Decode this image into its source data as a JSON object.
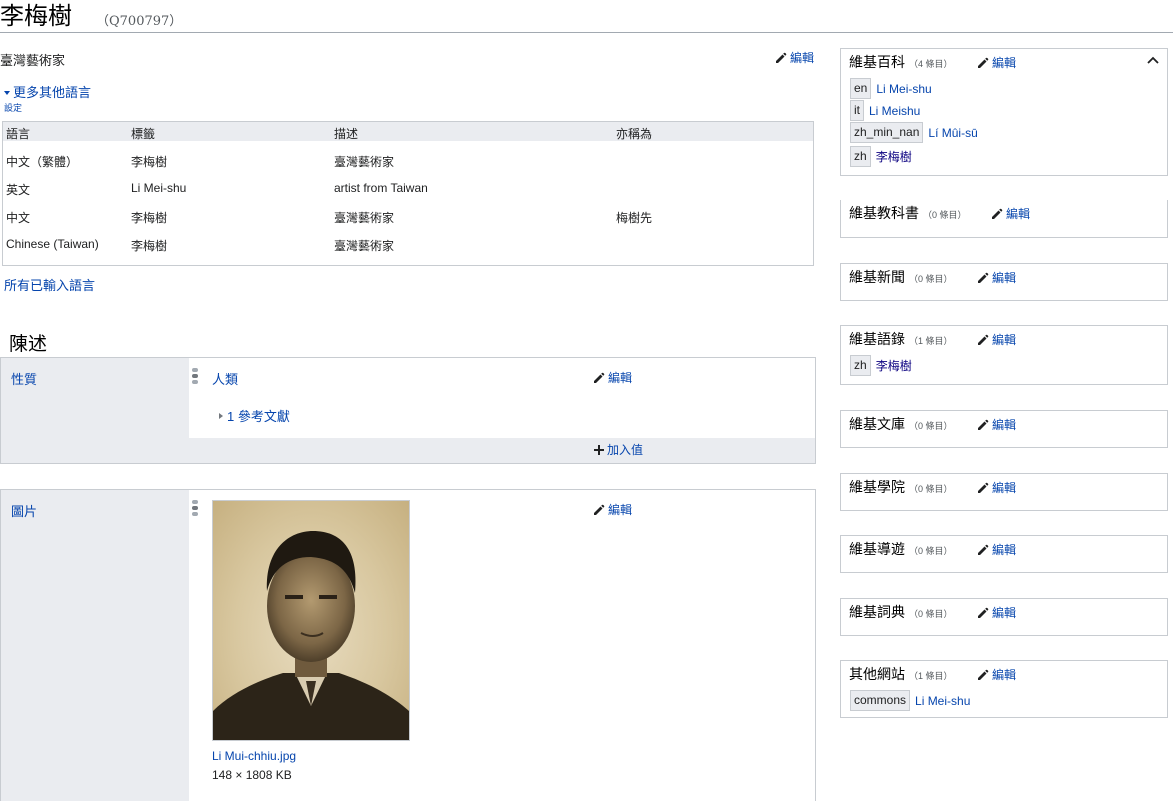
{
  "header": {
    "title": "李梅樹",
    "entity_id": "（Q700797）"
  },
  "edit_label": "編輯",
  "description": "臺灣藝術家",
  "more_languages": "更多其他語言",
  "settings": "設定",
  "languages_table": {
    "headers": [
      "語言",
      "標籤",
      "描述",
      "亦稱為"
    ],
    "rows": [
      [
        "中文（繁體）",
        "李梅樹",
        "臺灣藝術家",
        ""
      ],
      [
        "英文",
        "Li Mei-shu",
        "artist from Taiwan",
        ""
      ],
      [
        "中文",
        "李梅樹",
        "臺灣藝術家",
        "梅樹先"
      ],
      [
        "Chinese (Taiwan)",
        "李梅樹",
        "臺灣藝術家",
        ""
      ]
    ]
  },
  "all_languages": "所有已輸入語言",
  "statements_heading": "陳述",
  "statements": [
    {
      "property": "性質",
      "value": "人類",
      "references": "1 參考文獻",
      "add_value": "加入值"
    },
    {
      "property": "圖片",
      "file_name": "Li Mui-chhiu.jpg",
      "file_dims": "148 × 1808 KB"
    }
  ],
  "sitelinks": [
    {
      "title": "維基百科",
      "count": "（4 條目）",
      "links": [
        {
          "site": "en",
          "label": "Li Mei-shu"
        },
        {
          "site": "it",
          "label": "Li Meishu"
        },
        {
          "site": "zh_min_nan",
          "label": "Lí Mûi-sū"
        },
        {
          "site": "zh",
          "label": "李梅樹"
        }
      ]
    },
    {
      "title": "維基教科書",
      "count": "（0 條目）",
      "links": []
    },
    {
      "title": "維基新聞",
      "count": "（0 條目）",
      "links": []
    },
    {
      "title": "維基語錄",
      "count": "（1 條目）",
      "links": [
        {
          "site": "zh",
          "label": "李梅樹"
        }
      ]
    },
    {
      "title": "維基文庫",
      "count": "（0 條目）",
      "links": []
    },
    {
      "title": "維基學院",
      "count": "（0 條目）",
      "links": []
    },
    {
      "title": "維基導遊",
      "count": "（0 條目）",
      "links": []
    },
    {
      "title": "維基詞典",
      "count": "（0 條目）",
      "links": []
    },
    {
      "title": "其他網站",
      "count": "（1 條目）",
      "links": [
        {
          "site": "commons",
          "label": "Li Mei-shu"
        }
      ]
    }
  ],
  "colors": {
    "link": "#0645ad",
    "border": "#c8ccd1",
    "panel_gray": "#eaecf0"
  }
}
